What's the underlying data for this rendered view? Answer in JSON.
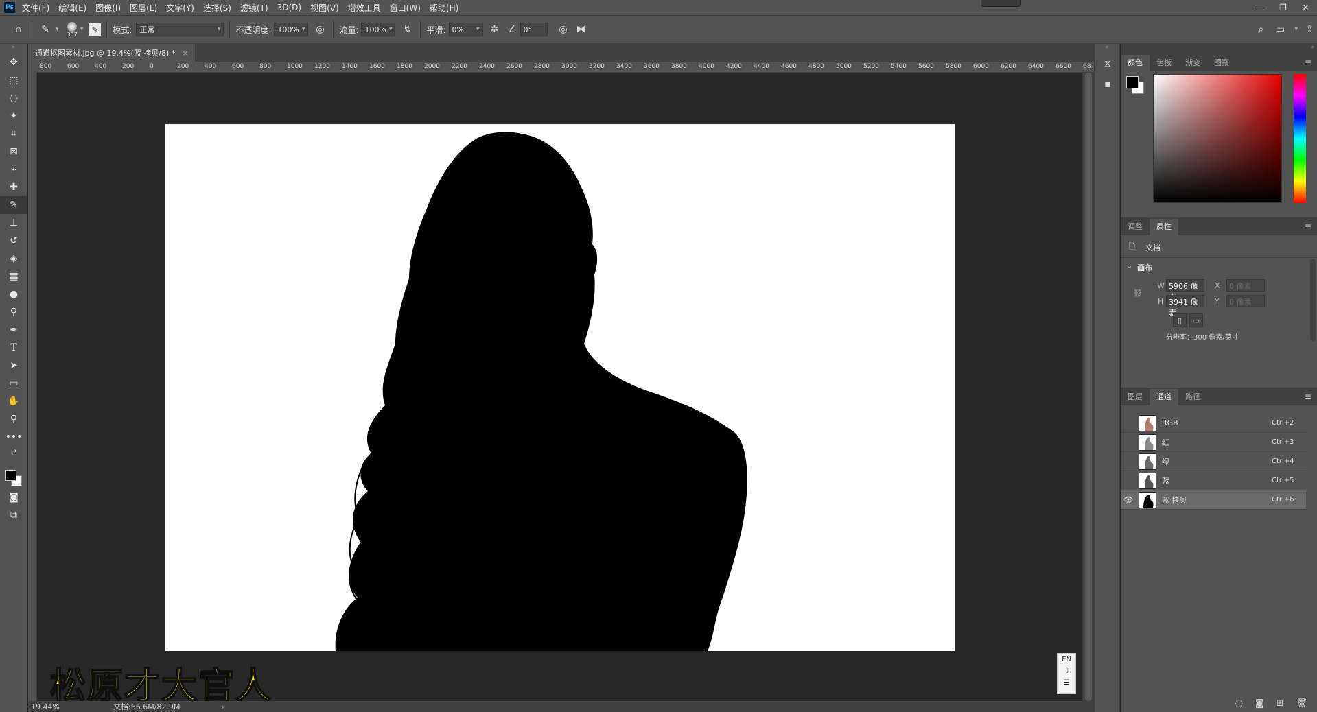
{
  "app": {
    "logo": "Ps",
    "menu": [
      "文件(F)",
      "编辑(E)",
      "图像(I)",
      "图层(L)",
      "文字(Y)",
      "选择(S)",
      "滤镜(T)",
      "3D(D)",
      "视图(V)",
      "增效工具",
      "窗口(W)",
      "帮助(H)"
    ],
    "window_controls": [
      "—",
      "❐",
      "✕"
    ]
  },
  "options": {
    "brush_size": "357",
    "mode_label": "模式:",
    "mode_value": "正常",
    "opacity_label": "不透明度:",
    "opacity_value": "100%",
    "flow_label": "流量:",
    "flow_value": "100%",
    "smoothing_label": "平滑:",
    "smoothing_value": "0%",
    "angle_value": "0°"
  },
  "document": {
    "tab_title": "通道抠图素材.jpg @ 19.4%(蓝 拷贝/8) *",
    "zoom": "19.44%",
    "doc_info": "文档:66.6M/82.9M",
    "ruler_top_labels": [
      "800",
      "600",
      "400",
      "200",
      "0",
      "200",
      "400",
      "600",
      "800",
      "1000",
      "1200",
      "1400",
      "1600",
      "1800",
      "2000",
      "2200",
      "2400",
      "2600",
      "2800",
      "3000",
      "3200",
      "3400",
      "3600",
      "3800",
      "4000",
      "4200",
      "4400",
      "4600",
      "4800",
      "5000",
      "5200",
      "5400",
      "5600",
      "5800",
      "6000",
      "6200",
      "6400",
      "6600",
      "68"
    ]
  },
  "caption": "松原才大官人",
  "ime": {
    "lang": "EN",
    "moon": "☽",
    "menu": "☰"
  },
  "color_panel": {
    "tabs": [
      "颜色",
      "色板",
      "渐变",
      "图案"
    ],
    "fg_color": "#000000",
    "bg_color": "#ffffff"
  },
  "properties_panel": {
    "tabs": [
      "调整",
      "属性"
    ],
    "doc_label": "文档",
    "section": "画布",
    "w_label": "W",
    "w_value": "5906 像素",
    "h_label": "H",
    "h_value": "3941 像素",
    "x_label": "X",
    "x_placeholder": "0 像素",
    "y_label": "Y",
    "y_placeholder": "0 像素",
    "resolution": "分辨率：300 像素/英寸"
  },
  "channels_panel": {
    "tabs": [
      "图层",
      "通道",
      "路径"
    ],
    "channels": [
      {
        "name": "RGB",
        "shortcut": "Ctrl+2",
        "visible": false,
        "selected": false
      },
      {
        "name": "红",
        "shortcut": "Ctrl+3",
        "visible": false,
        "selected": false
      },
      {
        "name": "绿",
        "shortcut": "Ctrl+4",
        "visible": false,
        "selected": false
      },
      {
        "name": "蓝",
        "shortcut": "Ctrl+5",
        "visible": false,
        "selected": false
      },
      {
        "name": "蓝 拷贝",
        "shortcut": "Ctrl+6",
        "visible": true,
        "selected": true
      }
    ]
  }
}
